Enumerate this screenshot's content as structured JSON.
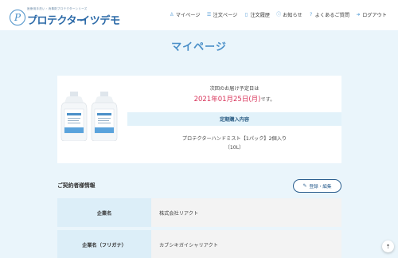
{
  "header": {
    "logo_tagline": "医療用手洗い・消毒剤プロテクターシリーズ",
    "logo_name": "プロテクター",
    "logo_sub": "イツデモ",
    "logo_mark": "P",
    "nav": [
      {
        "label": "マイページ",
        "icon": "user-icon",
        "glyph": "♙"
      },
      {
        "label": "注文ページ",
        "icon": "list-icon",
        "glyph": "☰"
      },
      {
        "label": "注文履歴",
        "icon": "document-icon",
        "glyph": "▯"
      },
      {
        "label": "お知らせ",
        "icon": "info-icon",
        "glyph": "ⓘ"
      },
      {
        "label": "よくあるご質問",
        "icon": "question-icon",
        "glyph": "?"
      },
      {
        "label": "ログアウト",
        "icon": "logout-icon",
        "glyph": "➜"
      }
    ]
  },
  "page_title": "マイページ",
  "order": {
    "delivery_text": "次回のお届け予定日は",
    "delivery_date": "2021年01月25日(月)",
    "delivery_suffix": "です。",
    "periodic_label": "定期購入内容",
    "product_line1": "プロテクターハンドミスト【1パック】2個入り",
    "product_line2": "（10L）"
  },
  "contract": {
    "title": "ご契約者様情報",
    "edit_button": "登録・編集",
    "rows": [
      {
        "label": "企業名",
        "value": "株式会社リアクト"
      },
      {
        "label": "企業名（フリガナ）",
        "value": "カブシキガイシャリアクト"
      }
    ]
  },
  "fab_glyph": "⇡",
  "colors": {
    "accent": "#4a8fc8",
    "date": "#d8335a",
    "background": "#eaf5fb",
    "label_bg": "#dceef8"
  }
}
